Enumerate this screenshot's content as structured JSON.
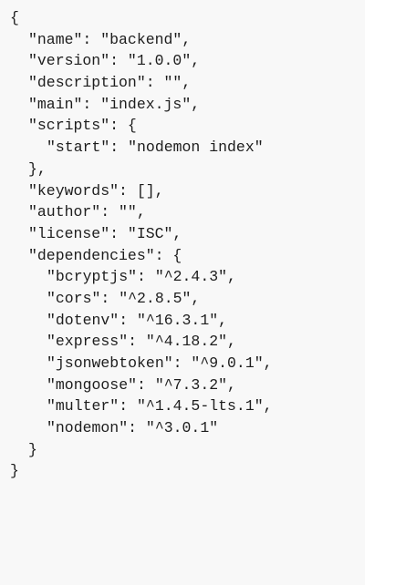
{
  "file": {
    "lines": [
      {
        "indent": 0,
        "text": "{"
      },
      {
        "indent": 1,
        "text": "\"name\": \"backend\","
      },
      {
        "indent": 1,
        "text": "\"version\": \"1.0.0\","
      },
      {
        "indent": 1,
        "text": "\"description\": \"\","
      },
      {
        "indent": 1,
        "text": "\"main\": \"index.js\","
      },
      {
        "indent": 1,
        "text": "\"scripts\": {"
      },
      {
        "indent": 2,
        "text": "\"start\": \"nodemon index\""
      },
      {
        "indent": 1,
        "text": "},"
      },
      {
        "indent": 1,
        "text": "\"keywords\": [],"
      },
      {
        "indent": 1,
        "text": "\"author\": \"\","
      },
      {
        "indent": 1,
        "text": "\"license\": \"ISC\","
      },
      {
        "indent": 1,
        "text": "\"dependencies\": {"
      },
      {
        "indent": 2,
        "text": "\"bcryptjs\": \"^2.4.3\","
      },
      {
        "indent": 2,
        "text": "\"cors\": \"^2.8.5\","
      },
      {
        "indent": 2,
        "text": "\"dotenv\": \"^16.3.1\","
      },
      {
        "indent": 2,
        "text": "\"express\": \"^4.18.2\","
      },
      {
        "indent": 2,
        "text": "\"jsonwebtoken\": \"^9.0.1\","
      },
      {
        "indent": 2,
        "text": "\"mongoose\": \"^7.3.2\","
      },
      {
        "indent": 2,
        "text": "\"multer\": \"^1.4.5-lts.1\","
      },
      {
        "indent": 2,
        "text": "\"nodemon\": \"^3.0.1\""
      },
      {
        "indent": 1,
        "text": "}"
      },
      {
        "indent": 0,
        "text": "}"
      }
    ]
  }
}
